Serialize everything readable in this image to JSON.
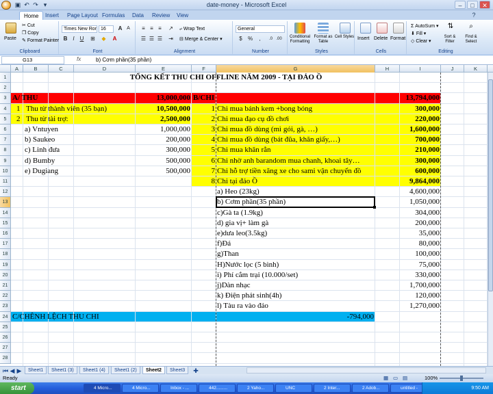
{
  "window": {
    "title": "date-money - Microsoft Excel"
  },
  "ribbon": {
    "tabs": [
      "Home",
      "Insert",
      "Page Layout",
      "Formulas",
      "Data",
      "Review",
      "View"
    ],
    "clipboard": {
      "paste": "Paste",
      "cut": "Cut",
      "copy": "Copy",
      "format_painter": "Format Painter",
      "label": "Clipboard"
    },
    "font": {
      "name": "Times New Rom",
      "size": "16",
      "label": "Font"
    },
    "alignment": {
      "wrap": "Wrap Text",
      "merge": "Merge & Center",
      "label": "Alignment"
    },
    "number": {
      "format": "General",
      "label": "Number",
      "currency": "$",
      "percent": "%",
      "comma": ","
    },
    "styles": {
      "conditional": "Conditional Formatting",
      "format_table": "Format as Table",
      "cell_styles": "Cell Styles",
      "label": "Styles"
    },
    "cells": {
      "insert": "Insert",
      "delete": "Delete",
      "format": "Format",
      "label": "Cells"
    },
    "editing": {
      "autosum": "AutoSum",
      "fill": "Fill",
      "clear": "Clear",
      "sort": "Sort & Filter",
      "find": "Find & Select",
      "label": "Editing"
    }
  },
  "formula_bar": {
    "name_box": "G13",
    "fx": "fx",
    "content": "b) Cơm phần(35 phần)"
  },
  "columns": [
    "A",
    "B",
    "C",
    "D",
    "E",
    "F",
    "G",
    "H",
    "I",
    "J",
    "K"
  ],
  "rows": [
    "1",
    "2",
    "3",
    "4",
    "5",
    "6",
    "7",
    "8",
    "9",
    "10",
    "11",
    "12",
    "13",
    "14",
    "15",
    "16",
    "17",
    "18",
    "19",
    "20",
    "21",
    "22",
    "23",
    "24",
    "25",
    "26",
    "27",
    "28"
  ],
  "cells": {
    "title": "TỔNG KẾT THU CHI OFFLINE NĂM 2009 - TẠI ĐẢO Ồ",
    "a_thu": "A/ THU",
    "a_thu_total": "13,000,000",
    "b_chi": "B/CHI",
    "b_chi_total": "13,794,000",
    "thu": [
      {
        "no": "1",
        "label": "Thu từ thành viên (35 bạn)",
        "amount": "10,500,000"
      },
      {
        "no": "2",
        "label": "Thu từ tài trợ:",
        "amount": "2,500,000"
      }
    ],
    "sponsors": [
      {
        "label": "a) Vntuyen",
        "amount": "1,000,000"
      },
      {
        "label": "b) Saukeo",
        "amount": "200,000"
      },
      {
        "label": "c) Linh đưa",
        "amount": "300,000"
      },
      {
        "label": "d) Bumby",
        "amount": "500,000"
      },
      {
        "label": "e) Dugiang",
        "amount": "500,000"
      }
    ],
    "chi": [
      {
        "no": "1",
        "label": "Chi mua bánh kem +bong bóng",
        "amount": "300,000"
      },
      {
        "no": "2",
        "label": "Chi mua đạo cụ đồ chơi",
        "amount": "220,000"
      },
      {
        "no": "3",
        "label": "Chi mua đồ dùng (mì gói, gà, …)",
        "amount": "1,600,000"
      },
      {
        "no": "4",
        "label": "Chi mua đồ dùng (bát đũa, khăn giấy,…)",
        "amount": "700,000"
      },
      {
        "no": "5",
        "label": "Chi mua khăn rằn",
        "amount": "210,000"
      },
      {
        "no": "6",
        "label": "Chi nhờ anh barandom mua chanh, khoai tây…",
        "amount": "300,000"
      },
      {
        "no": "7",
        "label": "Chi hỗ trợ tiền xăng xe cho sami vận chuyển đồ",
        "amount": "600,000"
      },
      {
        "no": "8",
        "label": "Chi tại đảo Ồ",
        "amount": "9,864,000"
      }
    ],
    "island": [
      {
        "label": "a) Heo (23kg)",
        "amount": "4,600,000"
      },
      {
        "label": "b) Cơm phần(35 phần)",
        "amount": "1,050,000"
      },
      {
        "label": "c)Gà ta (1.9kg)",
        "amount": "304,000"
      },
      {
        "label": "d) gia vị+ làm gà",
        "amount": "200,000"
      },
      {
        "label": "e)dưa leo(3.5kg)",
        "amount": "35,000"
      },
      {
        "label": "f)Đá",
        "amount": "80,000"
      },
      {
        "label": "g)Than",
        "amount": "100,000"
      },
      {
        "label": "H)Nước lọc (5 bình)",
        "amount": "75,000"
      },
      {
        "label": "i) Phí cắm trại (10.000/set)",
        "amount": "330,000"
      },
      {
        "label": "j)Dàn nhạc",
        "amount": "1,700,000"
      },
      {
        "label": "k) Điện phát sinh(4h)",
        "amount": "120,000"
      },
      {
        "label": "l) Tàu ra vào đảo",
        "amount": "1,270,000"
      }
    ],
    "c_label": "C/CHÊNH LỆCH THU CHI",
    "c_amount": "-794,000"
  },
  "sheet_tabs": [
    "Sheet1",
    "Sheet1 (3)",
    "Sheet1 (4)",
    "Sheet1 (2)",
    "Sheet2",
    "Sheet3"
  ],
  "active_sheet": "Sheet2",
  "status": {
    "left": "Ready",
    "zoom": "100%"
  },
  "taskbar": {
    "start": "start",
    "items": [
      "4 Micro...",
      "4 Micro...",
      "Inbox - ...",
      "442.........",
      "2 Yaho...",
      "UNC",
      "2 Inter...",
      "2 Adob...",
      "untitled -"
    ],
    "time": "9:50 AM"
  },
  "colors": {
    "red": "#ff0000",
    "yellow": "#ffff00",
    "cyan": "#00b0f0"
  }
}
